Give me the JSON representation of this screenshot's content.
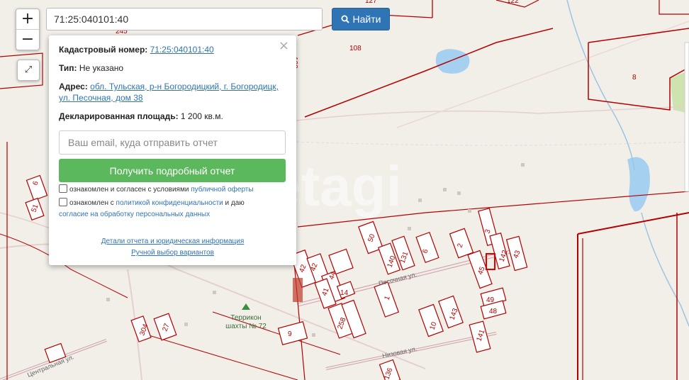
{
  "search": {
    "value": "71:25:040101:40",
    "button_label": "Найти"
  },
  "zoom": {
    "in_label": "+",
    "out_label": "−",
    "expand_label": "⤢"
  },
  "popup": {
    "close_label": "×",
    "cad_label": "Кадастровый номер:",
    "cad_value": "71:25:040101:40",
    "type_label": "Тип:",
    "type_value": "Не указано",
    "address_label": "Адрес:",
    "address_line1": "обл. Тульская, р-н Богородицкий, г. Богородицк,",
    "address_line2": "ул. Песочная, дом 38",
    "area_label": "Декларированная площадь:",
    "area_value": "1 200 кв.м.",
    "email_placeholder": "Ваш email, куда отправить отчет",
    "report_button": "Получить подробный отчет",
    "agree1_text": "ознакомлен и согласен с условиями",
    "agree1_link": "публичной оферты",
    "agree2_text": "ознакомлен с",
    "agree2_link": "политикой конфиденциальности",
    "agree2_text2": "и даю",
    "agree2_link2": "согласие на обработку персональных данных",
    "details_link": "Детали отчета и юридическая информация",
    "manual_link": "Ручной выбор вариантов"
  },
  "map_labels": {
    "terrikon": "Террикон",
    "shaft": "шахты № 72",
    "street_pesochnaya": "Песочная ул.",
    "street_nizovaya": "Низовая ул.",
    "street_tsentralnaya": "Центральная ул.",
    "watermark": "etagi"
  },
  "parcels": [
    "122",
    "127",
    "108",
    "245",
    "108",
    "8",
    "50",
    "131",
    "6",
    "2",
    "3",
    "142",
    "43",
    "140",
    "45",
    "42",
    "42",
    "44",
    "41",
    "14",
    "1",
    "49",
    "48",
    "143",
    "10",
    "141",
    "9",
    "258",
    "304",
    "27",
    "6",
    "51",
    "5",
    "136"
  ]
}
